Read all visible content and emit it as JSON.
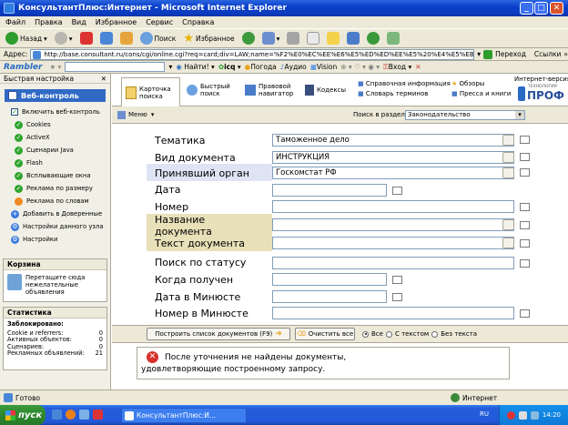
{
  "window": {
    "title": "КонсультантПлюс:Интернет - Microsoft Internet Explorer"
  },
  "menu": [
    "Файл",
    "Правка",
    "Вид",
    "Избранное",
    "Сервис",
    "Справка"
  ],
  "toolbar": {
    "back": "Назад",
    "search": "Поиск",
    "favorites": "Избранное"
  },
  "address": {
    "label": "Адрес:",
    "url": "http://base.consultant.ru/cons/cgi/online.cgi?req=card;div=LAW;name=%F2%E0%EC%EE%E6%E5%ED%ED%EE%E5%20%E4%E5%EB%EE%E4",
    "go": "Переход",
    "links": "Ссылки"
  },
  "rambler": {
    "logo": "Rambler",
    "find": "Найти!",
    "items": [
      "icq",
      "Погода",
      "Аудио",
      "Vision",
      "Вход"
    ]
  },
  "sidebar": {
    "quick": "Быстрая настройка",
    "web_control": "Веб-контроль",
    "enable": "Включить веб-контроль",
    "items": [
      "Cookies",
      "ActiveX",
      "Сценарии Java",
      "Flash",
      "Всплывающие окна",
      "Реклама по размеру",
      "Реклама по словам"
    ],
    "add_trusted": "Добавить в Доверенные",
    "node_settings": "Настройки данного узла",
    "settings": "Настройки",
    "basket": {
      "title": "Корзина",
      "text": "Перетащите сюда нежелательные объявления"
    },
    "stats": {
      "title": "Статистика",
      "blocked": "Заблокировано:",
      "rows": [
        {
          "k": "Cookie и referrers:",
          "v": "0"
        },
        {
          "k": "Активных объектов:",
          "v": "0"
        },
        {
          "k": "Сценариев:",
          "v": "0"
        },
        {
          "k": "Рекламных объявлений:",
          "v": "21"
        }
      ]
    }
  },
  "tabs": {
    "card": "Карточка поиска",
    "quick": "Быстрый поиск",
    "nav": "Правовой навигатор",
    "codes": "Кодексы",
    "ref_info": "Справочная информация",
    "dict": "Словарь терминов",
    "reviews": "Обзоры",
    "press": "Пресса и книги",
    "version": "Интернет-версия",
    "brand_top": "ТЕХНОЛОГИЯ",
    "brand": "ПРОФ"
  },
  "subbar": {
    "menu": "Меню",
    "search_in": "Поиск в разделе",
    "section": "Законодательство"
  },
  "fields": [
    {
      "label": "Тематика",
      "value": "Таможенное дело"
    },
    {
      "label": "Вид документа",
      "value": "ИНСТРУКЦИЯ"
    },
    {
      "label": "Принявший орган",
      "value": "Госкомстат РФ"
    },
    {
      "label": "Дата",
      "value": ""
    },
    {
      "label": "Номер",
      "value": ""
    },
    {
      "label": "Название документа",
      "value": ""
    },
    {
      "label": "Текст документа",
      "value": ""
    },
    {
      "label": "Поиск по статусу",
      "value": ""
    },
    {
      "label": "Когда получен",
      "value": ""
    },
    {
      "label": "Дата в Минюсте",
      "value": ""
    },
    {
      "label": "Номер в Минюсте",
      "value": ""
    }
  ],
  "actions": {
    "build": "Построить список документов (F9)",
    "clear": "Очистить все",
    "r_all": "Все",
    "r_text": "С текстом",
    "r_notext": "Без текста"
  },
  "message": {
    "line1": "После уточнения не найдены документы,",
    "line2": "удовлетворяющие построенному запросу."
  },
  "status": {
    "ready": "Готово",
    "zone": "Интернет"
  },
  "taskbar": {
    "start": "пуск",
    "app": "КонсультантПлюс:И...",
    "lang": "RU",
    "time": "14:20"
  }
}
